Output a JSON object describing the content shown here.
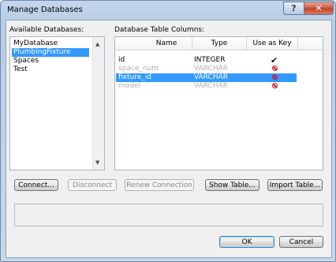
{
  "window": {
    "title": "Manage Databases",
    "help_label": "?",
    "close_label": "✕"
  },
  "available": {
    "label": "Available Databases:",
    "items": [
      {
        "label": "MyDatabase",
        "selected": false
      },
      {
        "label": "PlumbingFixture",
        "selected": true
      },
      {
        "label": "Spaces",
        "selected": false
      },
      {
        "label": "Test",
        "selected": false
      }
    ]
  },
  "columns_panel": {
    "label": "Database Table Columns:",
    "headers": {
      "name": "Name",
      "type": "Type",
      "key": "Use as Key"
    },
    "rows": [
      {
        "name": "id",
        "type": "INTEGER",
        "key": "check-icon",
        "state": "normal"
      },
      {
        "name": "space_num",
        "type": "VARCHAR",
        "key": "no-icon",
        "state": "disabled"
      },
      {
        "name": "fixture_id",
        "type": "VARCHAR",
        "key": "no-icon",
        "state": "selected"
      },
      {
        "name": "model",
        "type": "VARCHAR",
        "key": "no-icon",
        "state": "disabled"
      }
    ]
  },
  "buttons": {
    "connect": "Connect...",
    "disconnect": "Disconnect",
    "renew": "Renew Connection",
    "show_table": "Show Table...",
    "import_table": "Import Table...",
    "ok": "OK",
    "cancel": "Cancel"
  },
  "colors": {
    "selection": "#3399ff",
    "no_icon": "#d0132a",
    "disabled_text": "#b0b0b0"
  }
}
